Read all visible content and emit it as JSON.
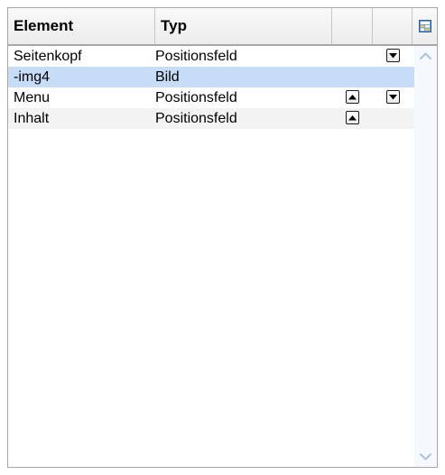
{
  "header": {
    "columns": [
      "Element",
      "Typ"
    ],
    "corner_icon": "grid-settings-icon"
  },
  "rows": [
    {
      "element": "Seitenkopf",
      "typ": "Positionsfeld",
      "move_up": false,
      "move_down": true
    },
    {
      "element": "-img4",
      "typ": "Bild",
      "move_up": false,
      "move_down": false,
      "selected": true
    },
    {
      "element": "Menu",
      "typ": "Positionsfeld",
      "move_up": true,
      "move_down": true
    },
    {
      "element": "Inhalt",
      "typ": "Positionsfeld",
      "move_up": true,
      "move_down": false
    }
  ],
  "icons": {
    "move_up": "arrow-up-icon",
    "move_down": "arrow-down-icon",
    "scroll_up": "chevron-up-icon",
    "scroll_down": "chevron-down-icon"
  },
  "colors": {
    "selected_row": "#c7dcf7",
    "alt_row": "#f3f3f3",
    "border": "#a7a7a7"
  }
}
